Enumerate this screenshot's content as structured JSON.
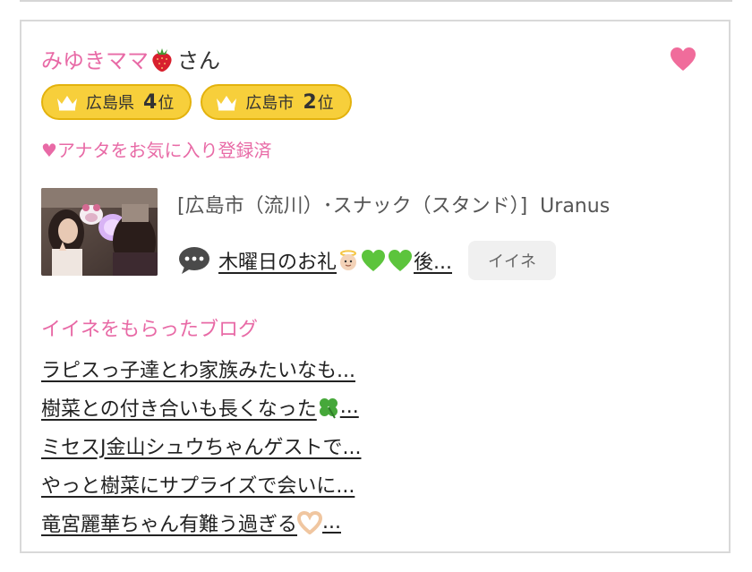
{
  "profile": {
    "name": "みゆきママ",
    "name_emoji": "strawberry-emoji",
    "honorific": "さん",
    "favorite_icon": "heart-icon",
    "favorite_color": "#f06c9b",
    "accent_pink": "#e86aa6"
  },
  "ranks": [
    {
      "area": "広島県",
      "rank": "4",
      "unit": "位"
    },
    {
      "area": "広島市",
      "rank": "2",
      "unit": "位"
    }
  ],
  "favorite_status": "♥アナタをお気に入り登録済",
  "shop": {
    "photo": "shop-photo",
    "location_category": "[広島市（流川）･スナック（スタンド）]",
    "name": "Uranus"
  },
  "latest_post": {
    "icon": "speech-bubble-icon",
    "title_text": "木曜日のお礼",
    "title_suffix": "後...",
    "emojis": [
      "baby-angel-emoji",
      "green-heart-emoji",
      "green-heart-emoji"
    ],
    "iine_label": "イイネ"
  },
  "liked_blogs": {
    "heading": "イイネをもらったブログ",
    "items": [
      {
        "text": "ラピスっ子達とわ家族みたいなも...",
        "emoji": ""
      },
      {
        "text": "樹菜との付き合いも長くなった",
        "emoji": "four-leaf-clover-emoji",
        "suffix": "..."
      },
      {
        "text": "ミセスJ金山シュウちゃんゲストで...",
        "emoji": ""
      },
      {
        "text": "やっと樹菜にサプライズで会いに...",
        "emoji": ""
      },
      {
        "text": "竜宮麗華ちゃん有難う過ぎる",
        "emoji": "heart-hands-emoji",
        "suffix": "..."
      }
    ]
  }
}
